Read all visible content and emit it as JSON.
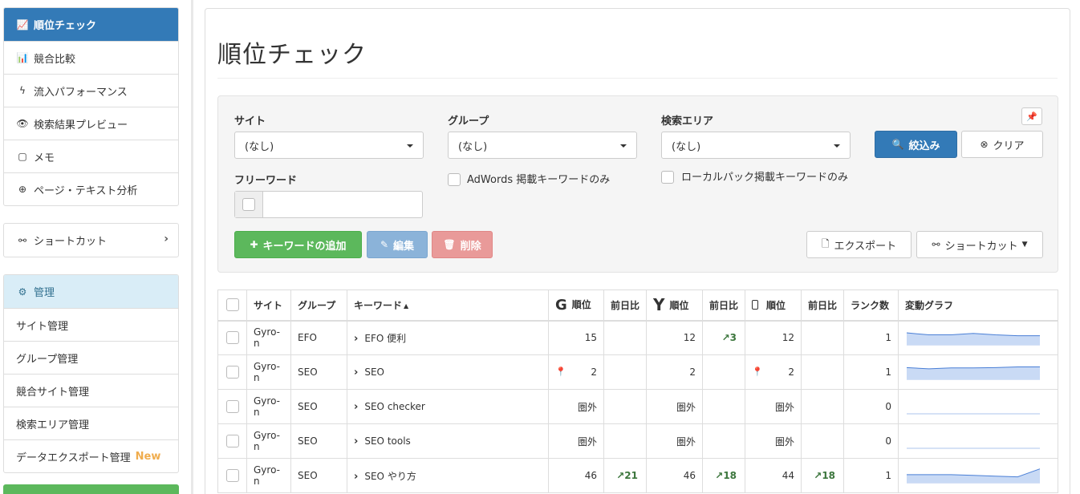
{
  "sidebar": {
    "main_items": [
      {
        "label": "順位チェック",
        "icon": "line-chart-icon",
        "glyph": "📈"
      },
      {
        "label": "競合比較",
        "icon": "bar-chart-icon",
        "glyph": "📊"
      },
      {
        "label": "流入パフォーマンス",
        "icon": "bolt-icon",
        "glyph": "ϟ"
      },
      {
        "label": "検索結果プレビュー",
        "icon": "eye-icon",
        "glyph": "👁"
      },
      {
        "label": "メモ",
        "icon": "note-icon",
        "glyph": "▢"
      },
      {
        "label": "ページ・テキスト分析",
        "icon": "search-plus-icon",
        "glyph": "⊕"
      }
    ],
    "shortcut": {
      "label": "ショートカット",
      "icon": "link-icon",
      "glyph": "⚯"
    },
    "admin_header": {
      "label": "管理",
      "icon": "gear-icon",
      "glyph": "⚙"
    },
    "admin_items": [
      {
        "label": "サイト管理"
      },
      {
        "label": "グループ管理"
      },
      {
        "label": "競合サイト管理"
      },
      {
        "label": "検索エリア管理"
      },
      {
        "label": "データエクスポート管理"
      }
    ],
    "new_badge": "New"
  },
  "page": {
    "title": "順位チェック"
  },
  "filter": {
    "site_label": "サイト",
    "site_value": "(なし)",
    "group_label": "グループ",
    "group_value": "(なし)",
    "area_label": "検索エリア",
    "area_value": "(なし)",
    "freeword_label": "フリーワード",
    "freeword_value": "",
    "adwords_only": "AdWords 掲載キーワードのみ",
    "localpack_only": "ローカルパック掲載キーワードのみ",
    "narrow_button": "絞込み",
    "clear_button": "クリア",
    "add_keyword_button": "キーワードの追加",
    "edit_button": "編集",
    "delete_button": "削除",
    "export_button": "エクスポート",
    "shortcut_button": "ショートカット"
  },
  "table": {
    "headers": {
      "site": "サイト",
      "group": "グループ",
      "keyword": "キーワード",
      "g_rank": "順位",
      "g_prev": "前日比",
      "y_rank": "順位",
      "y_prev": "前日比",
      "m_rank": "順位",
      "m_prev": "前日比",
      "rank_count": "ランク数",
      "graph": "変動グラフ"
    },
    "google_glyph": "G",
    "yahoo_glyph": "Y",
    "rows": [
      {
        "site": "Gyro-n",
        "group": "EFO",
        "keyword": "EFO 便利",
        "g_rank": "15",
        "g_prev": "",
        "g_pin": false,
        "y_rank": "12",
        "y_prev": "↗3",
        "m_rank": "12",
        "m_prev": "",
        "m_pin": false,
        "count": "1",
        "spark": [
          0.28,
          0.42,
          0.42,
          0.32,
          0.42,
          0.48,
          0.48
        ]
      },
      {
        "site": "Gyro-n",
        "group": "SEO",
        "keyword": "SEO",
        "g_rank": "2",
        "g_prev": "",
        "g_pin": true,
        "y_rank": "2",
        "y_prev": "",
        "m_rank": "2",
        "m_prev": "",
        "m_pin": true,
        "count": "1",
        "spark": [
          0.3,
          0.38,
          0.32,
          0.32,
          0.3,
          0.25,
          0.25
        ]
      },
      {
        "site": "Gyro-n",
        "group": "SEO",
        "keyword": "SEO checker",
        "g_rank": "圏外",
        "g_prev": "",
        "g_pin": false,
        "y_rank": "圏外",
        "y_prev": "",
        "m_rank": "圏外",
        "m_prev": "",
        "m_pin": false,
        "count": "0",
        "spark": []
      },
      {
        "site": "Gyro-n",
        "group": "SEO",
        "keyword": "SEO tools",
        "g_rank": "圏外",
        "g_prev": "",
        "g_pin": false,
        "y_rank": "圏外",
        "y_prev": "",
        "m_rank": "圏外",
        "m_prev": "",
        "m_pin": false,
        "count": "0",
        "spark": []
      },
      {
        "site": "Gyro-n",
        "group": "SEO",
        "keyword": "SEO やり方",
        "g_rank": "46",
        "g_prev": "↗21",
        "g_pin": false,
        "y_rank": "46",
        "y_prev": "↗18",
        "m_rank": "44",
        "m_prev": "↗18",
        "m_pin": false,
        "count": "1",
        "spark": [
          0.55,
          0.55,
          0.55,
          0.6,
          0.65,
          0.7,
          0.15
        ]
      }
    ]
  },
  "colors": {
    "primary": "#337ab7",
    "success": "#5cb85c",
    "new": "#f0ad4e",
    "spark_fill": "#c9daf5",
    "spark_line": "#4a7fd6"
  }
}
